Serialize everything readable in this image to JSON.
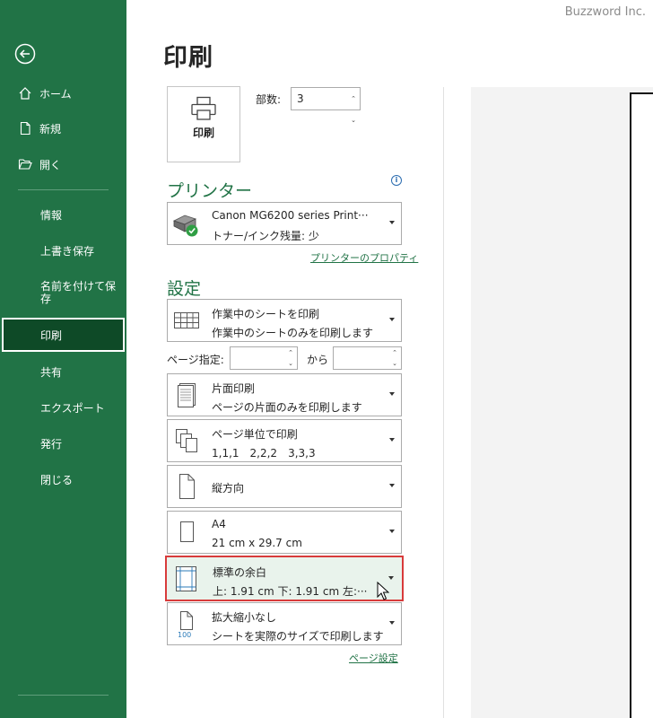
{
  "brand": "Buzzword Inc.",
  "nav": {
    "home": "ホーム",
    "new": "新規",
    "open": "開く",
    "info": "情報",
    "save": "上書き保存",
    "save_as": "名前を付けて保存",
    "print": "印刷",
    "share": "共有",
    "export": "エクスポート",
    "publish": "発行",
    "close": "閉じる"
  },
  "page_title": "印刷",
  "print_button": "印刷",
  "copies": {
    "label": "部数:",
    "value": "3"
  },
  "printer": {
    "heading": "プリンター",
    "name": "Canon MG6200 series Print···",
    "status": "トナー/インク残量: 少",
    "properties_link": "プリンターのプロパティ"
  },
  "settings": {
    "heading": "設定",
    "what": {
      "line1": "作業中のシートを印刷",
      "line2": "作業中のシートのみを印刷します"
    },
    "pages": {
      "label": "ページ指定:",
      "to": "から"
    },
    "sides": {
      "line1": "片面印刷",
      "line2": "ページの片面のみを印刷します"
    },
    "collate": {
      "line1": "ページ単位で印刷",
      "line2": "1,1,1　2,2,2　3,3,3"
    },
    "orientation": {
      "line1": "縦方向"
    },
    "paper": {
      "line1": "A4",
      "line2": "21 cm x 29.7 cm"
    },
    "margins": {
      "line1": "標準の余白",
      "line2": "上: 1.91 cm 下: 1.91 cm 左:···"
    },
    "scaling": {
      "line1": "拡大縮小なし",
      "line2": "シートを実際のサイズで印刷します",
      "icon_text": "100"
    },
    "page_setup_link": "ページ設定"
  },
  "colors": {
    "accent": "#217346",
    "highlight_border": "#d83b3b"
  }
}
